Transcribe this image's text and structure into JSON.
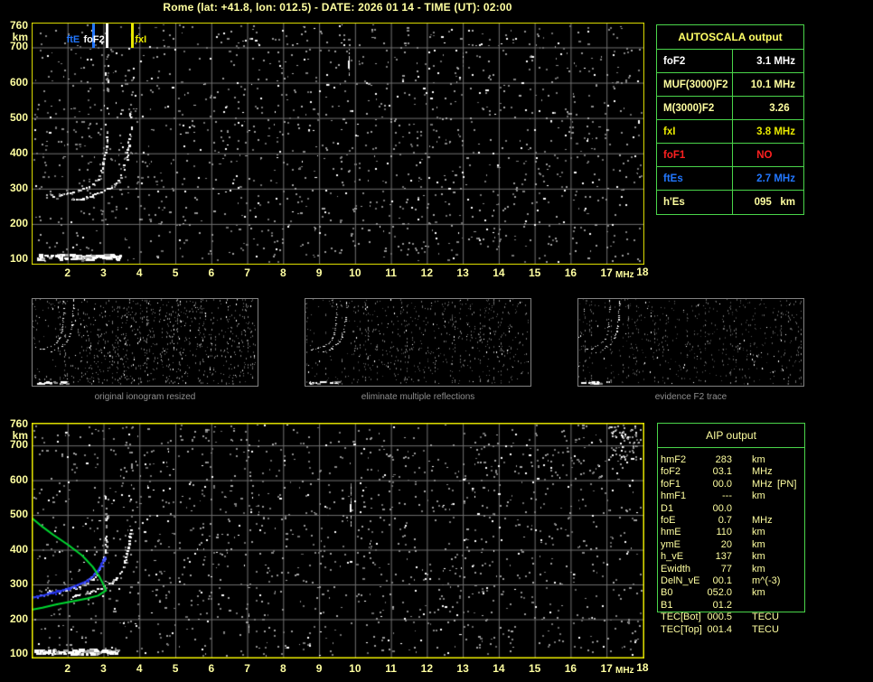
{
  "title": "Rome (lat: +41.8, lon: 012.5) - DATE: 2026 01 14 - TIME (UT): 02:00",
  "colors": {
    "background": "#000000",
    "plot_border": "#e8e800",
    "axis_text": "#ffffa0",
    "grid": "#6f6f6f",
    "panel_border": "#4ad54a",
    "caption_gray": "#8f8f8f",
    "profile_green": "#00d830",
    "fitted_blue": "#2b3cff",
    "marker_blue": "#2277ff",
    "alert_red": "#ff2020",
    "highlight_yellow": "#e8e800",
    "pale_yellow": "#ffffa0",
    "white": "#ffffff"
  },
  "chart_data": [
    {
      "type": "scatter",
      "x_unit": "MHz",
      "y_unit": "km",
      "xlim": [
        1,
        18
      ],
      "ylim": [
        100,
        760
      ],
      "grid": true,
      "x_ticks": [
        2,
        3,
        4,
        5,
        6,
        7,
        8,
        9,
        10,
        11,
        12,
        13,
        14,
        15,
        16,
        17
      ],
      "x_end_tick": 18,
      "y_ticks": [
        760,
        700,
        600,
        500,
        400,
        300,
        200,
        100
      ],
      "markers": [
        {
          "label": "ftE",
          "f": 2.7,
          "color": "#2277ff",
          "label_dx": -28
        },
        {
          "label": "foF2",
          "f": 3.1,
          "color": "#ffffff",
          "label_dx": -25
        },
        {
          "label": "fxI",
          "f": 3.8,
          "color": "#e8e800",
          "label_dx": 4
        }
      ],
      "series": [
        {
          "name": "O-trace",
          "color": "#ffffff",
          "points": [
            [
              1.38,
              279
            ],
            [
              1.7,
              282
            ],
            [
              2.0,
              287
            ],
            [
              2.3,
              294
            ],
            [
              2.55,
              304
            ],
            [
              2.75,
              318
            ],
            [
              2.88,
              336
            ],
            [
              2.97,
              360
            ],
            [
              3.03,
              392
            ],
            [
              3.07,
              424
            ],
            [
              3.09,
              452
            ]
          ]
        },
        {
          "name": "X-trace",
          "color": "#ffffff",
          "points": [
            [
              2.15,
              267
            ],
            [
              2.45,
              274
            ],
            [
              2.7,
              282
            ],
            [
              2.95,
              292
            ],
            [
              3.2,
              305
            ],
            [
              3.4,
              322
            ],
            [
              3.52,
              344
            ],
            [
              3.62,
              374
            ],
            [
              3.68,
              408
            ],
            [
              3.72,
              442
            ],
            [
              3.74,
              466
            ]
          ]
        },
        {
          "name": "Es-layer",
          "color": "#ffffff",
          "f_range": [
            1.08,
            3.45
          ],
          "km_range": [
            100,
            114
          ]
        }
      ]
    },
    {
      "type": "scatter",
      "x_unit": "MHz",
      "y_unit": "km",
      "xlim": [
        1,
        18
      ],
      "ylim": [
        100,
        760
      ],
      "grid": true,
      "x_ticks": [
        2,
        3,
        4,
        5,
        6,
        7,
        8,
        9,
        10,
        11,
        12,
        13,
        14,
        15,
        16,
        17
      ],
      "x_end_tick": 18,
      "y_ticks": [
        760,
        700,
        600,
        500,
        400,
        300,
        200,
        100
      ],
      "markers": [],
      "series": [
        {
          "name": "O-trace",
          "color": "#ffffff",
          "points": [
            [
              1.38,
              279
            ],
            [
              1.7,
              282
            ],
            [
              2.0,
              287
            ],
            [
              2.3,
              294
            ],
            [
              2.55,
              304
            ],
            [
              2.75,
              318
            ],
            [
              2.88,
              336
            ],
            [
              2.97,
              360
            ],
            [
              3.03,
              392
            ],
            [
              3.07,
              424
            ],
            [
              3.09,
              452
            ]
          ]
        },
        {
          "name": "X-trace",
          "color": "#ffffff",
          "points": [
            [
              2.15,
              267
            ],
            [
              2.45,
              274
            ],
            [
              2.7,
              282
            ],
            [
              2.95,
              292
            ],
            [
              3.2,
              305
            ],
            [
              3.4,
              322
            ],
            [
              3.52,
              344
            ],
            [
              3.62,
              374
            ],
            [
              3.68,
              408
            ],
            [
              3.72,
              442
            ],
            [
              3.74,
              466
            ]
          ]
        },
        {
          "name": "Es-layer",
          "color": "#ffffff",
          "f_range": [
            1.08,
            3.45
          ],
          "km_range": [
            100,
            114
          ]
        },
        {
          "name": "profile",
          "color": "#00d830",
          "points": [
            [
              1.0,
              492
            ],
            [
              1.3,
              466
            ],
            [
              1.6,
              443
            ],
            [
              2.0,
              415
            ],
            [
              2.4,
              384
            ],
            [
              2.7,
              351
            ],
            [
              2.9,
              320
            ],
            [
              3.0,
              299
            ],
            [
              3.07,
              283
            ],
            [
              2.85,
              268
            ],
            [
              2.55,
              260
            ],
            [
              2.1,
              251
            ],
            [
              1.7,
              243
            ],
            [
              1.3,
              233
            ],
            [
              1.0,
              227
            ]
          ]
        },
        {
          "name": "fitted",
          "color": "#2b3cff",
          "points": [
            [
              1.02,
              262
            ],
            [
              1.3,
              268
            ],
            [
              1.6,
              276
            ],
            [
              1.9,
              284
            ],
            [
              2.2,
              295
            ],
            [
              2.5,
              308
            ],
            [
              2.7,
              322
            ],
            [
              2.85,
              340
            ],
            [
              2.95,
              358
            ],
            [
              3.02,
              372
            ],
            [
              3.06,
              380
            ]
          ]
        }
      ]
    }
  ],
  "thumbnails": [
    {
      "caption": "original ionogram resized"
    },
    {
      "caption": "eliminate multiple reflections"
    },
    {
      "caption": "evidence F2 trace"
    }
  ],
  "autoscala": {
    "title": "AUTOSCALA output",
    "rows": [
      {
        "label": "foF2",
        "value": "3.1 MHz",
        "color": "#ffffff"
      },
      {
        "label": "MUF(3000)F2",
        "value": "10.1 MHz",
        "color": "#ffffa0"
      },
      {
        "label": "M(3000)F2",
        "value": "3.26  ",
        "color": "#ffffa0"
      },
      {
        "label": "fxI",
        "value": "3.8 MHz",
        "color": "#e8e800"
      },
      {
        "label": "foF1",
        "value": "NO        ",
        "color": "#ff2020"
      },
      {
        "label": "ftEs",
        "value": "2.7 MHz",
        "color": "#2277ff"
      },
      {
        "label": "h'Es",
        "value": "095   km",
        "color": "#ffffa0"
      }
    ]
  },
  "aip": {
    "title": "AIP output",
    "rows": [
      {
        "label": "hmF2",
        "value": "283",
        "unit": "km",
        "flag": ""
      },
      {
        "label": "foF2",
        "value": "03.1",
        "unit": "MHz",
        "flag": ""
      },
      {
        "label": "foF1",
        "value": "00.0",
        "unit": "MHz",
        "flag": "[PN]"
      },
      {
        "label": "hmF1",
        "value": "---",
        "unit": "km",
        "flag": ""
      },
      {
        "label": "D1",
        "value": "00.0",
        "unit": "",
        "flag": ""
      },
      {
        "label": "foE",
        "value": "0.7",
        "unit": "MHz",
        "flag": ""
      },
      {
        "label": "hmE",
        "value": "110",
        "unit": "km",
        "flag": ""
      },
      {
        "label": "ymE",
        "value": "20",
        "unit": "km",
        "flag": ""
      },
      {
        "label": "h_vE",
        "value": "137",
        "unit": "km",
        "flag": ""
      },
      {
        "label": "Ewidth",
        "value": "77",
        "unit": "km",
        "flag": ""
      },
      {
        "label": "DelN_vE",
        "value": "00.1",
        "unit": "m^(-3)",
        "flag": ""
      },
      {
        "label": "B0",
        "value": "052.0",
        "unit": "km",
        "flag": ""
      },
      {
        "label": "B1",
        "value": "01.2",
        "unit": "",
        "flag": ""
      },
      {
        "label": "TEC[Bot]",
        "value": "000.5",
        "unit": "TECU",
        "flag": ""
      },
      {
        "label": "TEC[Top]",
        "value": "001.4",
        "unit": "TECU",
        "flag": ""
      }
    ]
  }
}
